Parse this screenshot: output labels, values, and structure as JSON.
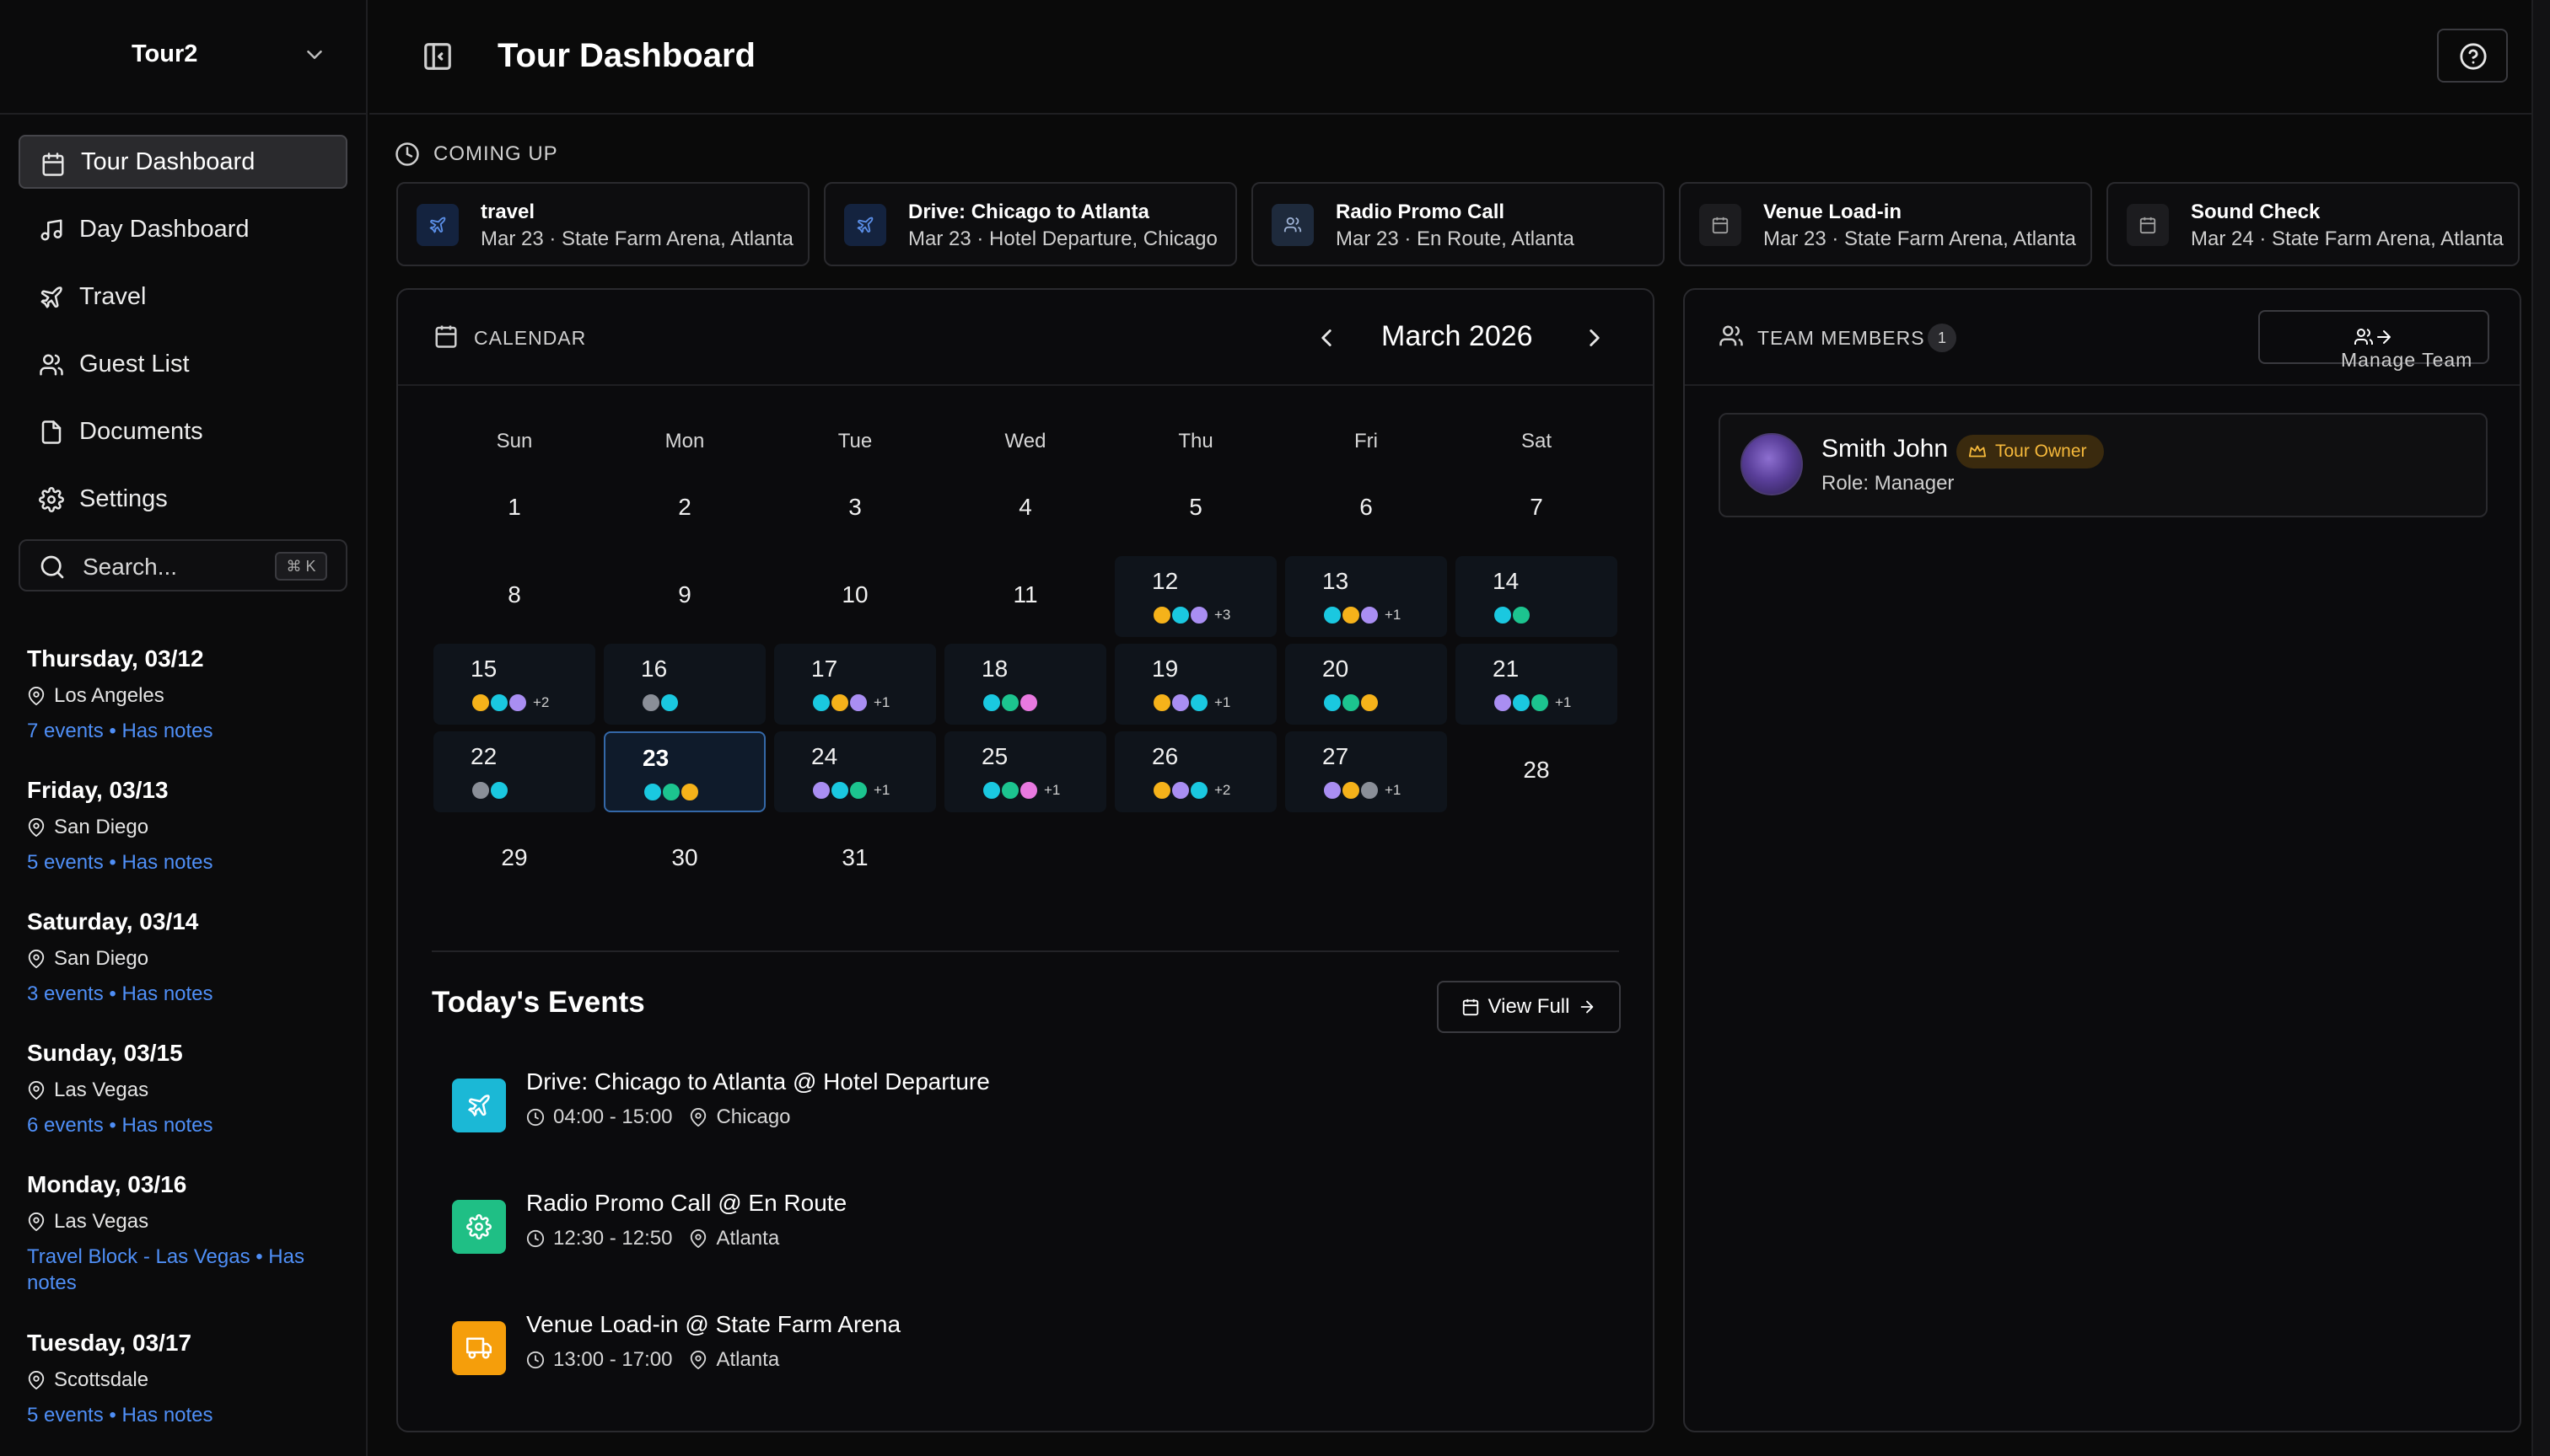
{
  "sidebar": {
    "project_name": "Tour2",
    "nav": [
      {
        "label": "Tour Dashboard",
        "icon": "calendar-icon",
        "active": true
      },
      {
        "label": "Day Dashboard",
        "icon": "music-note-icon"
      },
      {
        "label": "Travel",
        "icon": "plane-icon"
      },
      {
        "label": "Guest List",
        "icon": "users-icon"
      },
      {
        "label": "Documents",
        "icon": "document-icon"
      },
      {
        "label": "Settings",
        "icon": "gear-icon"
      }
    ],
    "search": {
      "label": "Search...",
      "shortcut": "⌘ K"
    },
    "days": [
      {
        "date": "Thursday, 03/12",
        "location": "Los Angeles",
        "events": "7 events • Has notes"
      },
      {
        "date": "Friday, 03/13",
        "location": "San Diego",
        "events": "5 events • Has notes"
      },
      {
        "date": "Saturday, 03/14",
        "location": "San Diego",
        "events": "3 events • Has notes"
      },
      {
        "date": "Sunday, 03/15",
        "location": "Las Vegas",
        "events": "6 events • Has notes"
      },
      {
        "date": "Monday, 03/16",
        "location": "Las Vegas",
        "events": "Travel Block - Las Vegas • Has notes"
      },
      {
        "date": "Tuesday, 03/17",
        "location": "Scottsdale",
        "events": "5 events • Has notes"
      }
    ]
  },
  "header": {
    "title": "Tour Dashboard"
  },
  "coming_up": {
    "heading": "COMING UP",
    "items": [
      {
        "title": "travel",
        "subtitle": "Mar 23 · State Farm Arena, Atlanta",
        "icon": "plane-icon"
      },
      {
        "title": "Drive: Chicago to Atlanta",
        "subtitle": "Mar 23 · Hotel Departure, Chicago",
        "icon": "plane-icon"
      },
      {
        "title": "Radio Promo Call",
        "subtitle": "Mar 23 · En Route, Atlanta",
        "icon": "users-icon"
      },
      {
        "title": "Venue Load-in",
        "subtitle": "Mar 23 · State Farm Arena, Atlanta",
        "icon": "calendar-icon"
      },
      {
        "title": "Sound Check",
        "subtitle": "Mar 24 · State Farm Arena, Atlanta",
        "icon": "calendar-icon"
      }
    ]
  },
  "calendar": {
    "heading": "CALENDAR",
    "month_label": "March 2026",
    "weekdays": [
      "Sun",
      "Mon",
      "Tue",
      "Wed",
      "Thu",
      "Fri",
      "Sat"
    ],
    "colors": {
      "yellow": "#f5b21a",
      "cyan": "#1ac8e0",
      "purple": "#a98ef2",
      "green": "#1cc48f",
      "gray": "#8a8f98",
      "pink": "#e879e0"
    },
    "today": 23,
    "days": [
      {
        "n": "1"
      },
      {
        "n": "2"
      },
      {
        "n": "3"
      },
      {
        "n": "4"
      },
      {
        "n": "5"
      },
      {
        "n": "6"
      },
      {
        "n": "7"
      },
      {
        "n": "8"
      },
      {
        "n": "9"
      },
      {
        "n": "10"
      },
      {
        "n": "11"
      },
      {
        "n": "12",
        "dots": [
          "yellow",
          "cyan",
          "purple"
        ],
        "more": "+3"
      },
      {
        "n": "13",
        "dots": [
          "cyan",
          "yellow",
          "purple"
        ],
        "more": "+1"
      },
      {
        "n": "14",
        "dots": [
          "cyan",
          "green"
        ]
      },
      {
        "n": "15",
        "dots": [
          "yellow",
          "cyan",
          "purple"
        ],
        "more": "+2"
      },
      {
        "n": "16",
        "dots": [
          "gray",
          "cyan"
        ]
      },
      {
        "n": "17",
        "dots": [
          "cyan",
          "yellow",
          "purple"
        ],
        "more": "+1"
      },
      {
        "n": "18",
        "dots": [
          "cyan",
          "green",
          "pink"
        ]
      },
      {
        "n": "19",
        "dots": [
          "yellow",
          "purple",
          "cyan"
        ],
        "more": "+1"
      },
      {
        "n": "20",
        "dots": [
          "cyan",
          "green",
          "yellow"
        ]
      },
      {
        "n": "21",
        "dots": [
          "purple",
          "cyan",
          "green"
        ],
        "more": "+1"
      },
      {
        "n": "22",
        "dots": [
          "gray",
          "cyan"
        ]
      },
      {
        "n": "23",
        "dots": [
          "cyan",
          "green",
          "yellow"
        ]
      },
      {
        "n": "24",
        "dots": [
          "purple",
          "cyan",
          "green"
        ],
        "more": "+1"
      },
      {
        "n": "25",
        "dots": [
          "cyan",
          "green",
          "pink"
        ],
        "more": "+1"
      },
      {
        "n": "26",
        "dots": [
          "yellow",
          "purple",
          "cyan"
        ],
        "more": "+2"
      },
      {
        "n": "27",
        "dots": [
          "purple",
          "yellow",
          "gray"
        ],
        "more": "+1"
      },
      {
        "n": "28"
      },
      {
        "n": "29"
      },
      {
        "n": "30"
      },
      {
        "n": "31"
      }
    ]
  },
  "todays_events": {
    "heading": "Today's Events",
    "view_full_label": "View Full",
    "items": [
      {
        "title": "Drive: Chicago to Atlanta @ Hotel Departure",
        "time": "04:00 - 15:00",
        "location": "Chicago",
        "icon": "plane-icon",
        "color": "#1bb8d6"
      },
      {
        "title": "Radio Promo Call @ En Route",
        "time": "12:30 - 12:50",
        "location": "Atlanta",
        "icon": "gear-icon",
        "color": "#1fbf85"
      },
      {
        "title": "Venue Load-in @ State Farm Arena",
        "time": "13:00 - 17:00",
        "location": "Atlanta",
        "icon": "truck-icon",
        "color": "#f59e0b"
      }
    ]
  },
  "team": {
    "heading": "TEAM MEMBERS",
    "count": "1",
    "manage_label": "Manage Team",
    "members": [
      {
        "name": "Smith John",
        "badge": "Tour Owner",
        "role": "Role: Manager"
      }
    ]
  }
}
